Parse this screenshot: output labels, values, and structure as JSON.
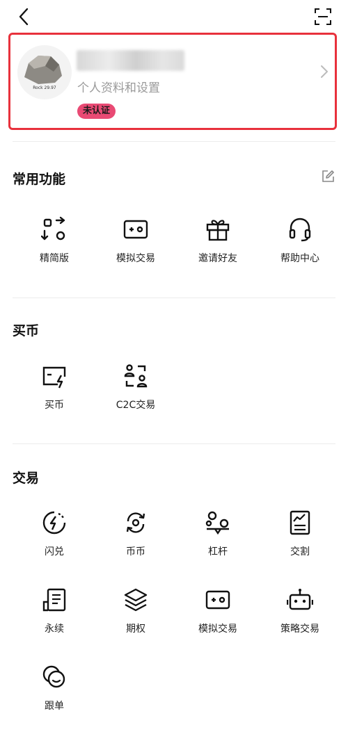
{
  "profile": {
    "subtitle": "个人资料和设置",
    "verify_badge": "未认证",
    "avatar_caption": "Rock 29.97"
  },
  "sections": {
    "common": {
      "title": "常用功能",
      "items": [
        {
          "label": "精简版",
          "icon": "lite-switch-icon"
        },
        {
          "label": "模拟交易",
          "icon": "demo-gamepad-icon"
        },
        {
          "label": "邀请好友",
          "icon": "gift-icon"
        },
        {
          "label": "帮助中心",
          "icon": "headset-icon"
        }
      ]
    },
    "buy": {
      "title": "买币",
      "items": [
        {
          "label": "买币",
          "icon": "buy-card-icon"
        },
        {
          "label": "C2C交易",
          "icon": "c2c-users-icon"
        }
      ]
    },
    "trade": {
      "title": "交易",
      "items": [
        {
          "label": "闪兑",
          "icon": "flash-icon"
        },
        {
          "label": "币币",
          "icon": "swap-cycle-icon"
        },
        {
          "label": "杠杆",
          "icon": "leverage-icon"
        },
        {
          "label": "交割",
          "icon": "delivery-doc-icon"
        },
        {
          "label": "永续",
          "icon": "perpetual-doc-icon"
        },
        {
          "label": "期权",
          "icon": "options-layers-icon"
        },
        {
          "label": "模拟交易",
          "icon": "demo-gamepad-icon"
        },
        {
          "label": "策略交易",
          "icon": "robot-icon"
        },
        {
          "label": "跟单",
          "icon": "copy-trade-icon"
        }
      ]
    }
  },
  "colors": {
    "accent_red": "#e8313c",
    "badge_pink": "#e94a74"
  }
}
